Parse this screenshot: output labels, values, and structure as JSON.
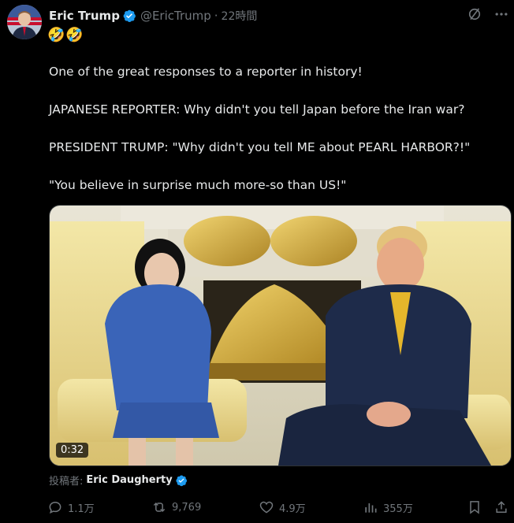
{
  "header": {
    "author_name": "Eric Trump",
    "handle": "@EricTrump",
    "separator": "·",
    "timestamp": "22時間",
    "emoji": "🤣🤣",
    "icons": [
      "grok-icon",
      "more-icon"
    ]
  },
  "tweet": {
    "lines": [
      "One of the great responses to a reporter in history!",
      "JAPANESE REPORTER: Why didn't you tell Japan before the Iran war?",
      "PRESIDENT TRUMP: \"Why didn't you tell ME about PEARL HARBOR?!\"",
      "\"You believe in surprise much more-so than US!\""
    ]
  },
  "media": {
    "duration": "0:32"
  },
  "credit": {
    "label": "投稿者:",
    "name": "Eric Daugherty"
  },
  "actions": {
    "replies": "1.1万",
    "reposts": "9,769",
    "likes": "4.9万",
    "views": "355万"
  },
  "colors": {
    "background": "#000000",
    "text": "#e7e9ea",
    "muted": "#71767b",
    "verified": "#1d9bf0"
  }
}
